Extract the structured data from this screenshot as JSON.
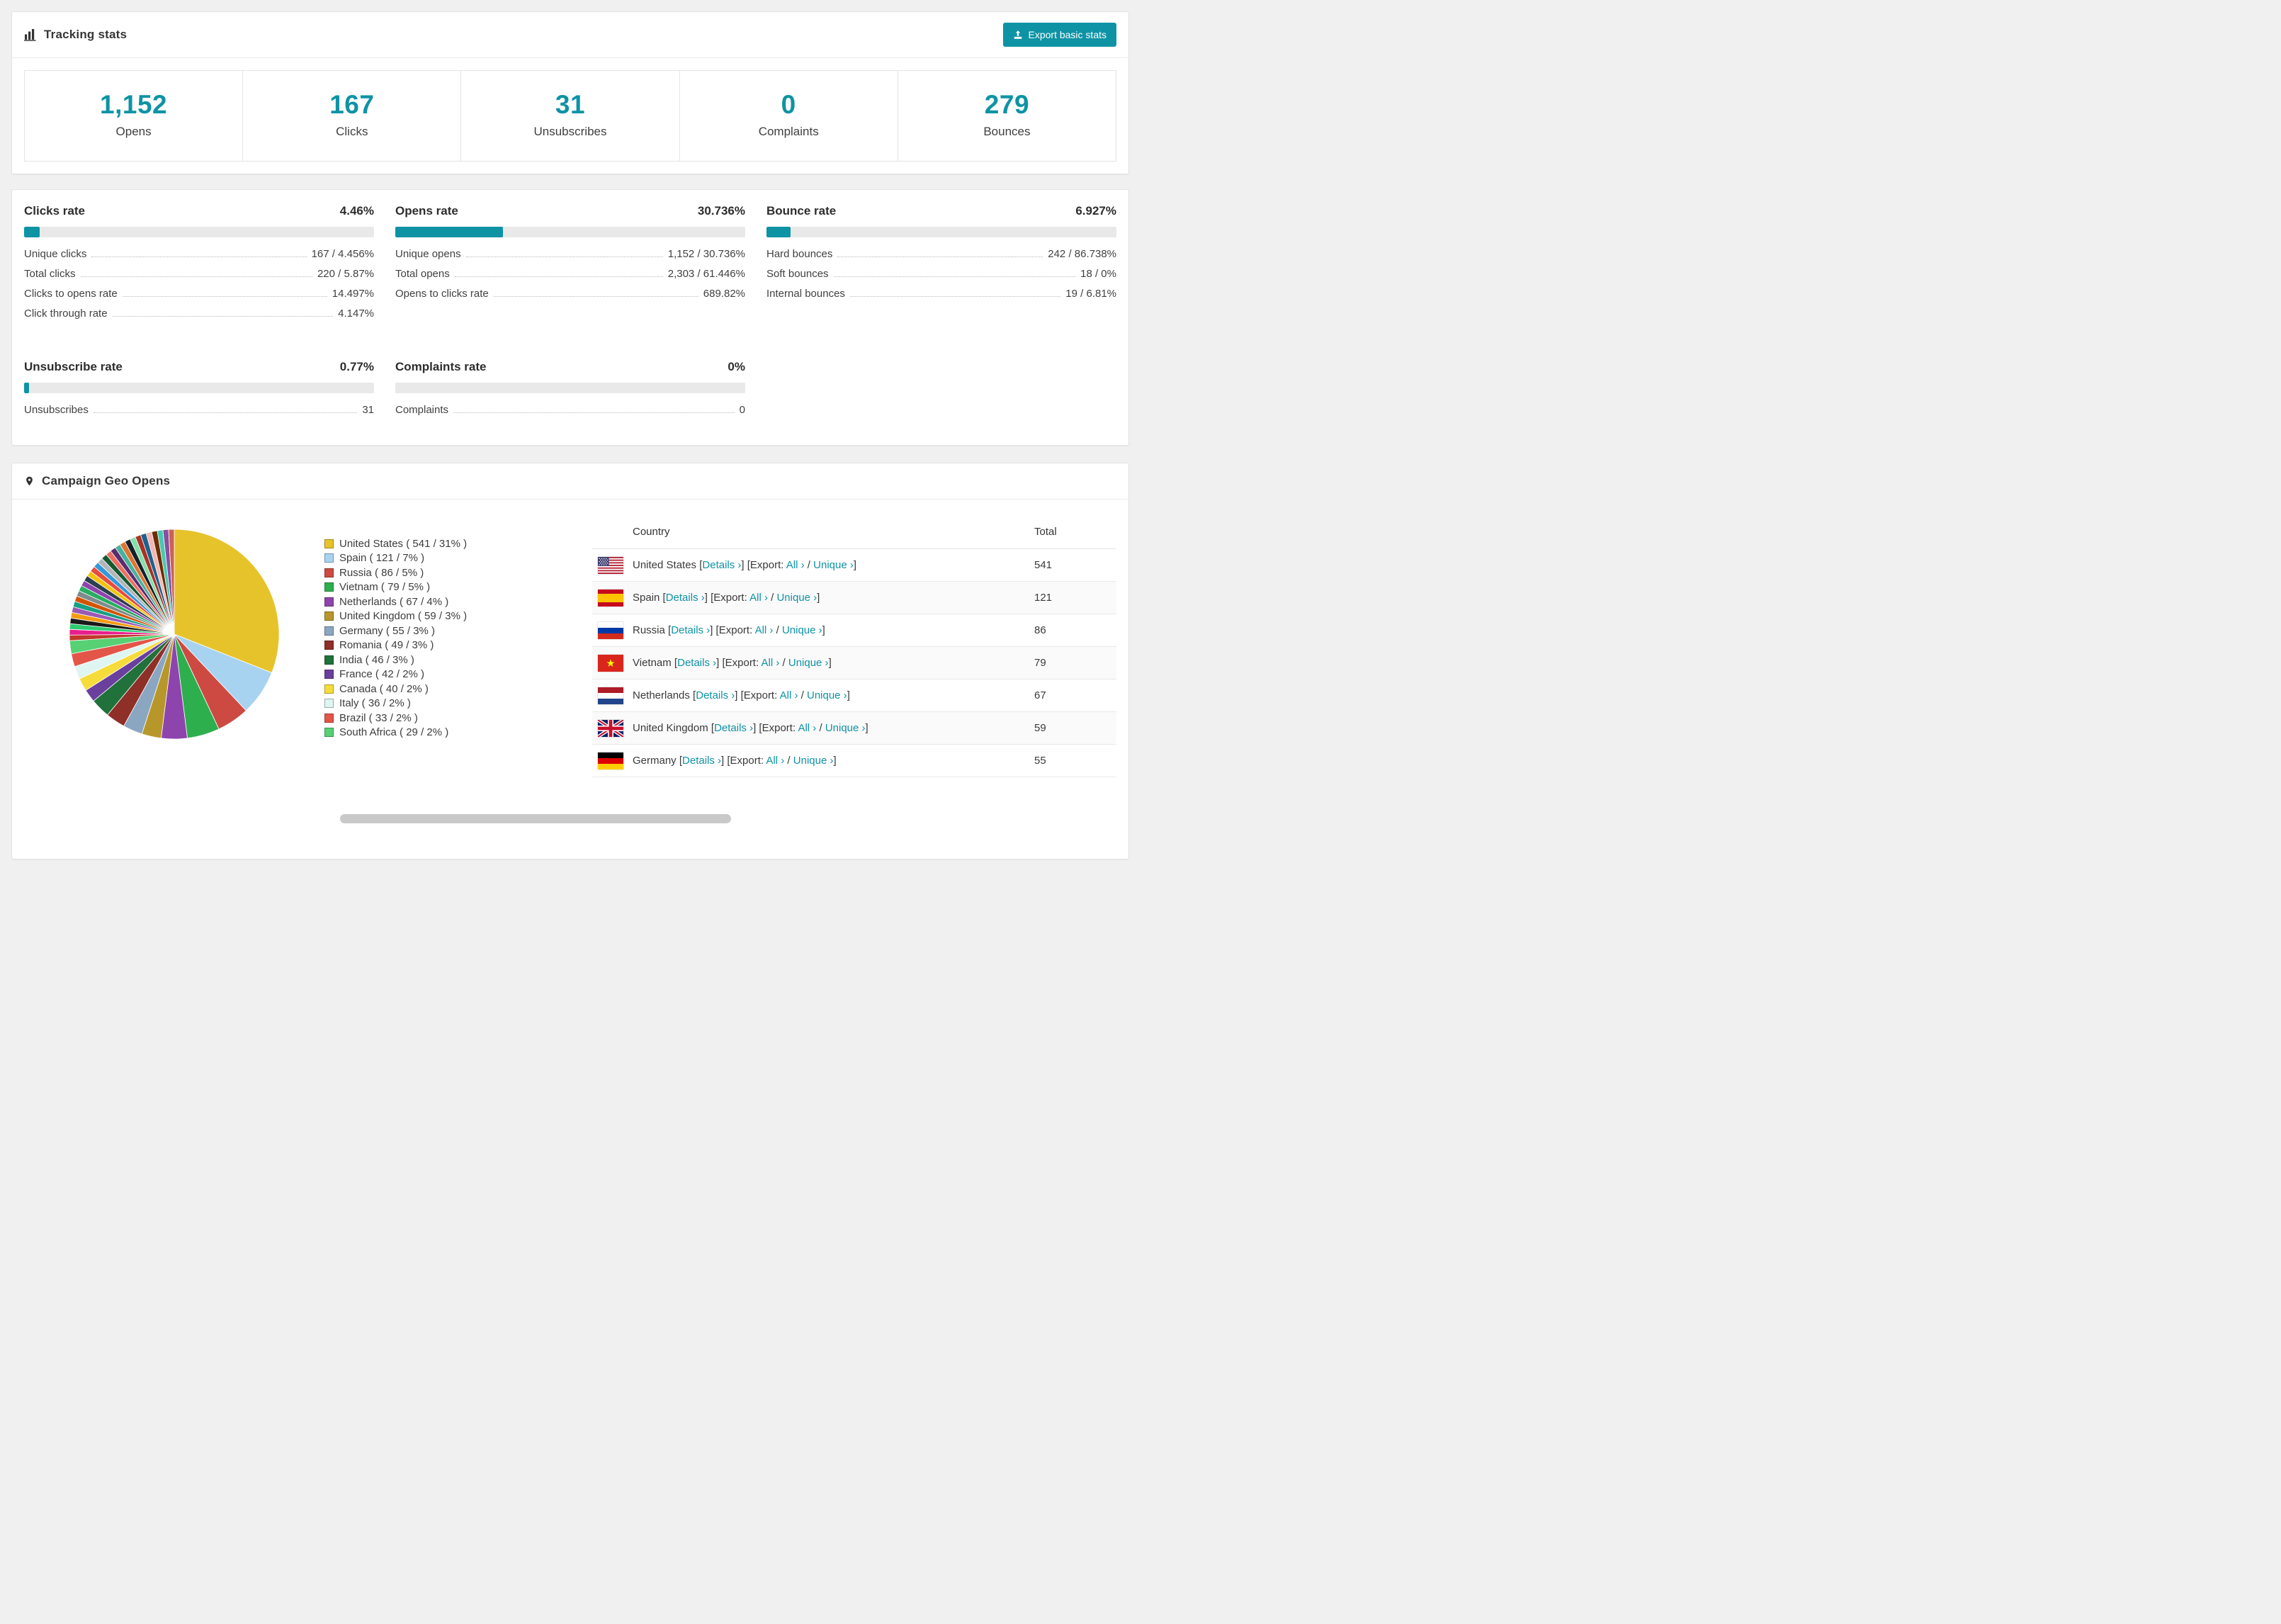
{
  "colors": {
    "accent": "#0e93a5"
  },
  "tracking": {
    "title": "Tracking stats",
    "export_button": "Export basic stats",
    "stats": [
      {
        "value": "1,152",
        "label": "Opens"
      },
      {
        "value": "167",
        "label": "Clicks"
      },
      {
        "value": "31",
        "label": "Unsubscribes"
      },
      {
        "value": "0",
        "label": "Complaints"
      },
      {
        "value": "279",
        "label": "Bounces"
      }
    ]
  },
  "rates": [
    {
      "id": "clicks-rate",
      "title": "Clicks rate",
      "percent": "4.46%",
      "bar": 4.46,
      "rows": [
        {
          "label": "Unique clicks",
          "value": "167 / 4.456%"
        },
        {
          "label": "Total clicks",
          "value": "220 / 5.87%"
        },
        {
          "label": "Clicks to opens rate",
          "value": "14.497%"
        },
        {
          "label": "Click through rate",
          "value": "4.147%"
        }
      ]
    },
    {
      "id": "opens-rate",
      "title": "Opens rate",
      "percent": "30.736%",
      "bar": 30.736,
      "rows": [
        {
          "label": "Unique opens",
          "value": "1,152 / 30.736%"
        },
        {
          "label": "Total opens",
          "value": "2,303 / 61.446%"
        },
        {
          "label": "Opens to clicks rate",
          "value": "689.82%"
        }
      ]
    },
    {
      "id": "bounce-rate",
      "title": "Bounce rate",
      "percent": "6.927%",
      "bar": 6.927,
      "rows": [
        {
          "label": "Hard bounces",
          "value": "242 / 86.738%"
        },
        {
          "label": "Soft bounces",
          "value": "18 / 0%"
        },
        {
          "label": "Internal bounces",
          "value": "19 / 6.81%"
        }
      ]
    },
    {
      "id": "unsubscribe-rate",
      "title": "Unsubscribe rate",
      "percent": "0.77%",
      "bar": 0.77,
      "rows": [
        {
          "label": "Unsubscribes",
          "value": "31"
        }
      ]
    },
    {
      "id": "complaints-rate",
      "title": "Complaints rate",
      "percent": "0%",
      "bar": 0,
      "rows": [
        {
          "label": "Complaints",
          "value": "0"
        }
      ]
    }
  ],
  "geo": {
    "title": "Campaign Geo Opens",
    "chart_data": {
      "type": "pie",
      "title": "Campaign Geo Opens",
      "legend_position": "right",
      "slices": [
        {
          "label": "United States",
          "value": 541,
          "pct": 31,
          "color": "#e7c32b",
          "legend_label": "United States ( 541 / 31% )"
        },
        {
          "label": "Spain",
          "value": 121,
          "pct": 7,
          "color": "#a8d3f0",
          "legend_label": "Spain ( 121 / 7% )"
        },
        {
          "label": "Russia",
          "value": 86,
          "pct": 5,
          "color": "#cd4a42",
          "legend_label": "Russia ( 86 / 5% )"
        },
        {
          "label": "Vietnam",
          "value": 79,
          "pct": 5,
          "color": "#2eaf4e",
          "legend_label": "Vietnam ( 79 / 5% )"
        },
        {
          "label": "Netherlands",
          "value": 67,
          "pct": 4,
          "color": "#8e44ad",
          "legend_label": "Netherlands ( 67 / 4% )"
        },
        {
          "label": "United Kingdom",
          "value": 59,
          "pct": 3,
          "color": "#b8972a",
          "legend_label": "United Kingdom ( 59 / 3% )"
        },
        {
          "label": "Germany",
          "value": 55,
          "pct": 3,
          "color": "#8ba6c1",
          "legend_label": "Germany ( 55 / 3% )"
        },
        {
          "label": "Romania",
          "value": 49,
          "pct": 3,
          "color": "#8e2f28",
          "legend_label": "Romania ( 49 / 3% )"
        },
        {
          "label": "India",
          "value": 46,
          "pct": 3,
          "color": "#20713a",
          "legend_label": "India ( 46 / 3% )"
        },
        {
          "label": "France",
          "value": 42,
          "pct": 2,
          "color": "#6a3f9e",
          "legend_label": "France ( 42 / 2% )"
        },
        {
          "label": "Canada",
          "value": 40,
          "pct": 2,
          "color": "#f6dc3a",
          "legend_label": "Canada ( 40 / 2% )"
        },
        {
          "label": "Italy",
          "value": 36,
          "pct": 2,
          "color": "#dff5f2",
          "legend_label": "Italy ( 36 / 2% )"
        },
        {
          "label": "Brazil",
          "value": 33,
          "pct": 2,
          "color": "#e25548",
          "legend_label": "Brazil ( 33 / 2% )"
        },
        {
          "label": "South Africa",
          "value": 29,
          "pct": 2,
          "color": "#57d173",
          "legend_label": "South Africa ( 29 / 2% )"
        }
      ],
      "other_total_pct": 26,
      "other_colors": [
        "#c0392b",
        "#e91e8c",
        "#2ecc71",
        "#1a1a1a",
        "#f39c12",
        "#9b59b6",
        "#16a085",
        "#d35400",
        "#7f8c8d",
        "#27ae60",
        "#8e44ad",
        "#2c3e50",
        "#f1c40f",
        "#e74c3c",
        "#3498db",
        "#b3b6b7",
        "#145a32",
        "#ec7063",
        "#5b2c6f",
        "#45b39d",
        "#dc7633",
        "#17202a",
        "#82e0aa",
        "#a93226",
        "#1f618d",
        "#f5b7b1",
        "#6e2c00",
        "#48c9b0",
        "#884ea0",
        "#cd6155"
      ]
    },
    "table": {
      "headers": [
        "Country",
        "Total"
      ],
      "details_label": "Details ›",
      "export_label": "[Export:",
      "all_label": "All ›",
      "unique_label": "Unique ›",
      "bracket_open": "[",
      "bracket_close": "]",
      "slash": "/",
      "rows": [
        {
          "country": "United States",
          "flag": "us",
          "total": "541"
        },
        {
          "country": "Spain",
          "flag": "es",
          "total": "121"
        },
        {
          "country": "Russia",
          "flag": "ru",
          "total": "86"
        },
        {
          "country": "Vietnam",
          "flag": "vn",
          "total": "79"
        },
        {
          "country": "Netherlands",
          "flag": "nl",
          "total": "67"
        },
        {
          "country": "United Kingdom",
          "flag": "gb",
          "total": "59"
        },
        {
          "country": "Germany",
          "flag": "de",
          "total": "55"
        }
      ]
    }
  }
}
